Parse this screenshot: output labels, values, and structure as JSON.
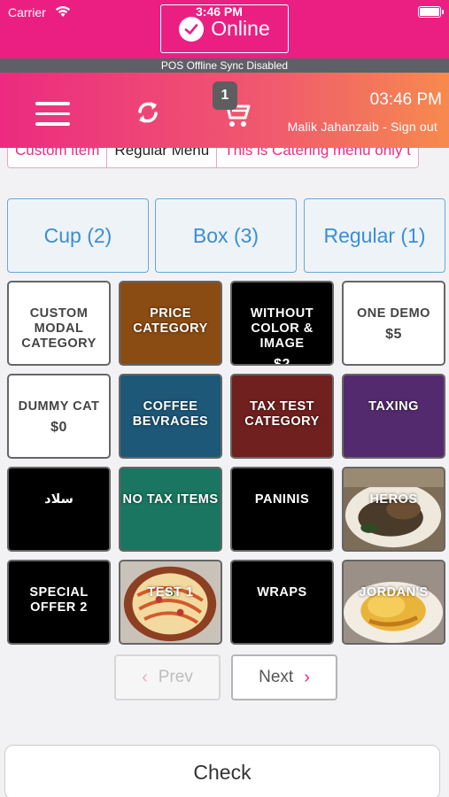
{
  "status_bar": {
    "carrier": "Carrier",
    "time": "3:46 PM"
  },
  "online_button": {
    "label": "Online"
  },
  "sync_banner": "POS Offline Sync Disabled",
  "header": {
    "cart_count": "1",
    "time": "03:46 PM",
    "user": "Malik Jahanzaib - Sign out"
  },
  "menu_tabs": [
    "Custom item",
    "Regular Menu",
    "This is Catering menu only t"
  ],
  "categories": [
    "Cup (2)",
    "Box (3)",
    "Regular (1)"
  ],
  "items": [
    {
      "name": "CUSTOM MODAL CATEGORY",
      "price": "",
      "bg": "#ffffff"
    },
    {
      "name": "PRICE CATEGORY",
      "price": "",
      "bg": "#8b4c13"
    },
    {
      "name": "WITHOUT COLOR & IMAGE",
      "price": "$2",
      "bg": "#000000"
    },
    {
      "name": "ONE DEMO",
      "price": "$5",
      "bg": "#ffffff"
    },
    {
      "name": "DUMMY CAT",
      "price": "$0",
      "bg": "#ffffff"
    },
    {
      "name": "COFFEE BEVRAGES",
      "price": "",
      "bg": "#1d5878"
    },
    {
      "name": "TAX TEST CATEGORY",
      "price": "",
      "bg": "#70201e"
    },
    {
      "name": "TAXING",
      "price": "",
      "bg": "#542a6e"
    },
    {
      "name": "سلاد",
      "price": "",
      "bg": "#000000"
    },
    {
      "name": "NO TAX ITEMS",
      "price": "",
      "bg": "#1a7660"
    },
    {
      "name": "PANINIS",
      "price": "",
      "bg": "#000000"
    },
    {
      "name": "HEROS",
      "price": "",
      "bg": "#6a5a48"
    },
    {
      "name": "SPECIAL OFFER 2",
      "price": "",
      "bg": "#000000"
    },
    {
      "name": "TEST 1",
      "price": "",
      "bg": "#b94a30"
    },
    {
      "name": "WRAPS",
      "price": "",
      "bg": "#000000"
    },
    {
      "name": "JORDAN'S",
      "price": "",
      "bg": "#d9a634"
    }
  ],
  "pagination": {
    "prev": "Prev",
    "next": "Next"
  },
  "check_button": "Check",
  "colors": {
    "brand_pink": "#eb1f82",
    "category_blue": "#3a8ed4"
  }
}
